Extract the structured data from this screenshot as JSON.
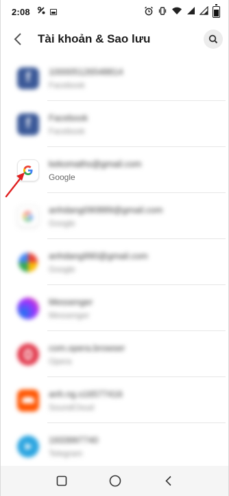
{
  "status_bar": {
    "time": "2:08",
    "left_icons": [
      "phone-link-icon",
      "gallery-icon"
    ],
    "right_icons": [
      "alarm-icon",
      "vibrate-icon",
      "wifi-icon",
      "signal-icon",
      "signal-icon",
      "battery-icon"
    ]
  },
  "header": {
    "title": "Tài khoản & Sao lưu",
    "back_icon": "back-arrow-icon",
    "search_icon": "search-icon"
  },
  "accounts": [
    {
      "primary": "100005126548814",
      "secondary": "Facebook",
      "icon": "facebook-icon",
      "blurred": true
    },
    {
      "primary": "Facebook",
      "secondary": "Facebook",
      "icon": "facebook-icon",
      "blurred": true
    },
    {
      "primary": "kekomaths@gmail.com",
      "secondary": "Google",
      "icon": "google-icon",
      "blurred": false,
      "highlighted": true
    },
    {
      "primary": "anhdang090889@gmail.com",
      "secondary": "Google",
      "icon": "google-icon",
      "blurred": true
    },
    {
      "primary": "anhdang990@gmail.com",
      "secondary": "Google",
      "icon": "google-photos-icon",
      "blurred": true
    },
    {
      "primary": "Messenger",
      "secondary": "Messenger",
      "icon": "messenger-icon",
      "blurred": true
    },
    {
      "primary": "com.opera.browser",
      "secondary": "Opera",
      "icon": "opera-icon",
      "blurred": true
    },
    {
      "primary": "anh.ng.s16577416",
      "secondary": "SoundCloud",
      "icon": "soundcloud-icon",
      "blurred": true
    },
    {
      "primary": "1933997740",
      "secondary": "Telegram",
      "icon": "telegram-icon",
      "blurred": true
    }
  ],
  "annotation": {
    "color": "#e02020",
    "icon": "red-arrow-icon"
  },
  "nav_bar": {
    "buttons": [
      "recent-apps-icon",
      "home-icon",
      "back-icon"
    ]
  },
  "colors": {
    "background": "#ffffff",
    "nav_background": "#f5f5f5",
    "accent_red": "#e02020"
  }
}
